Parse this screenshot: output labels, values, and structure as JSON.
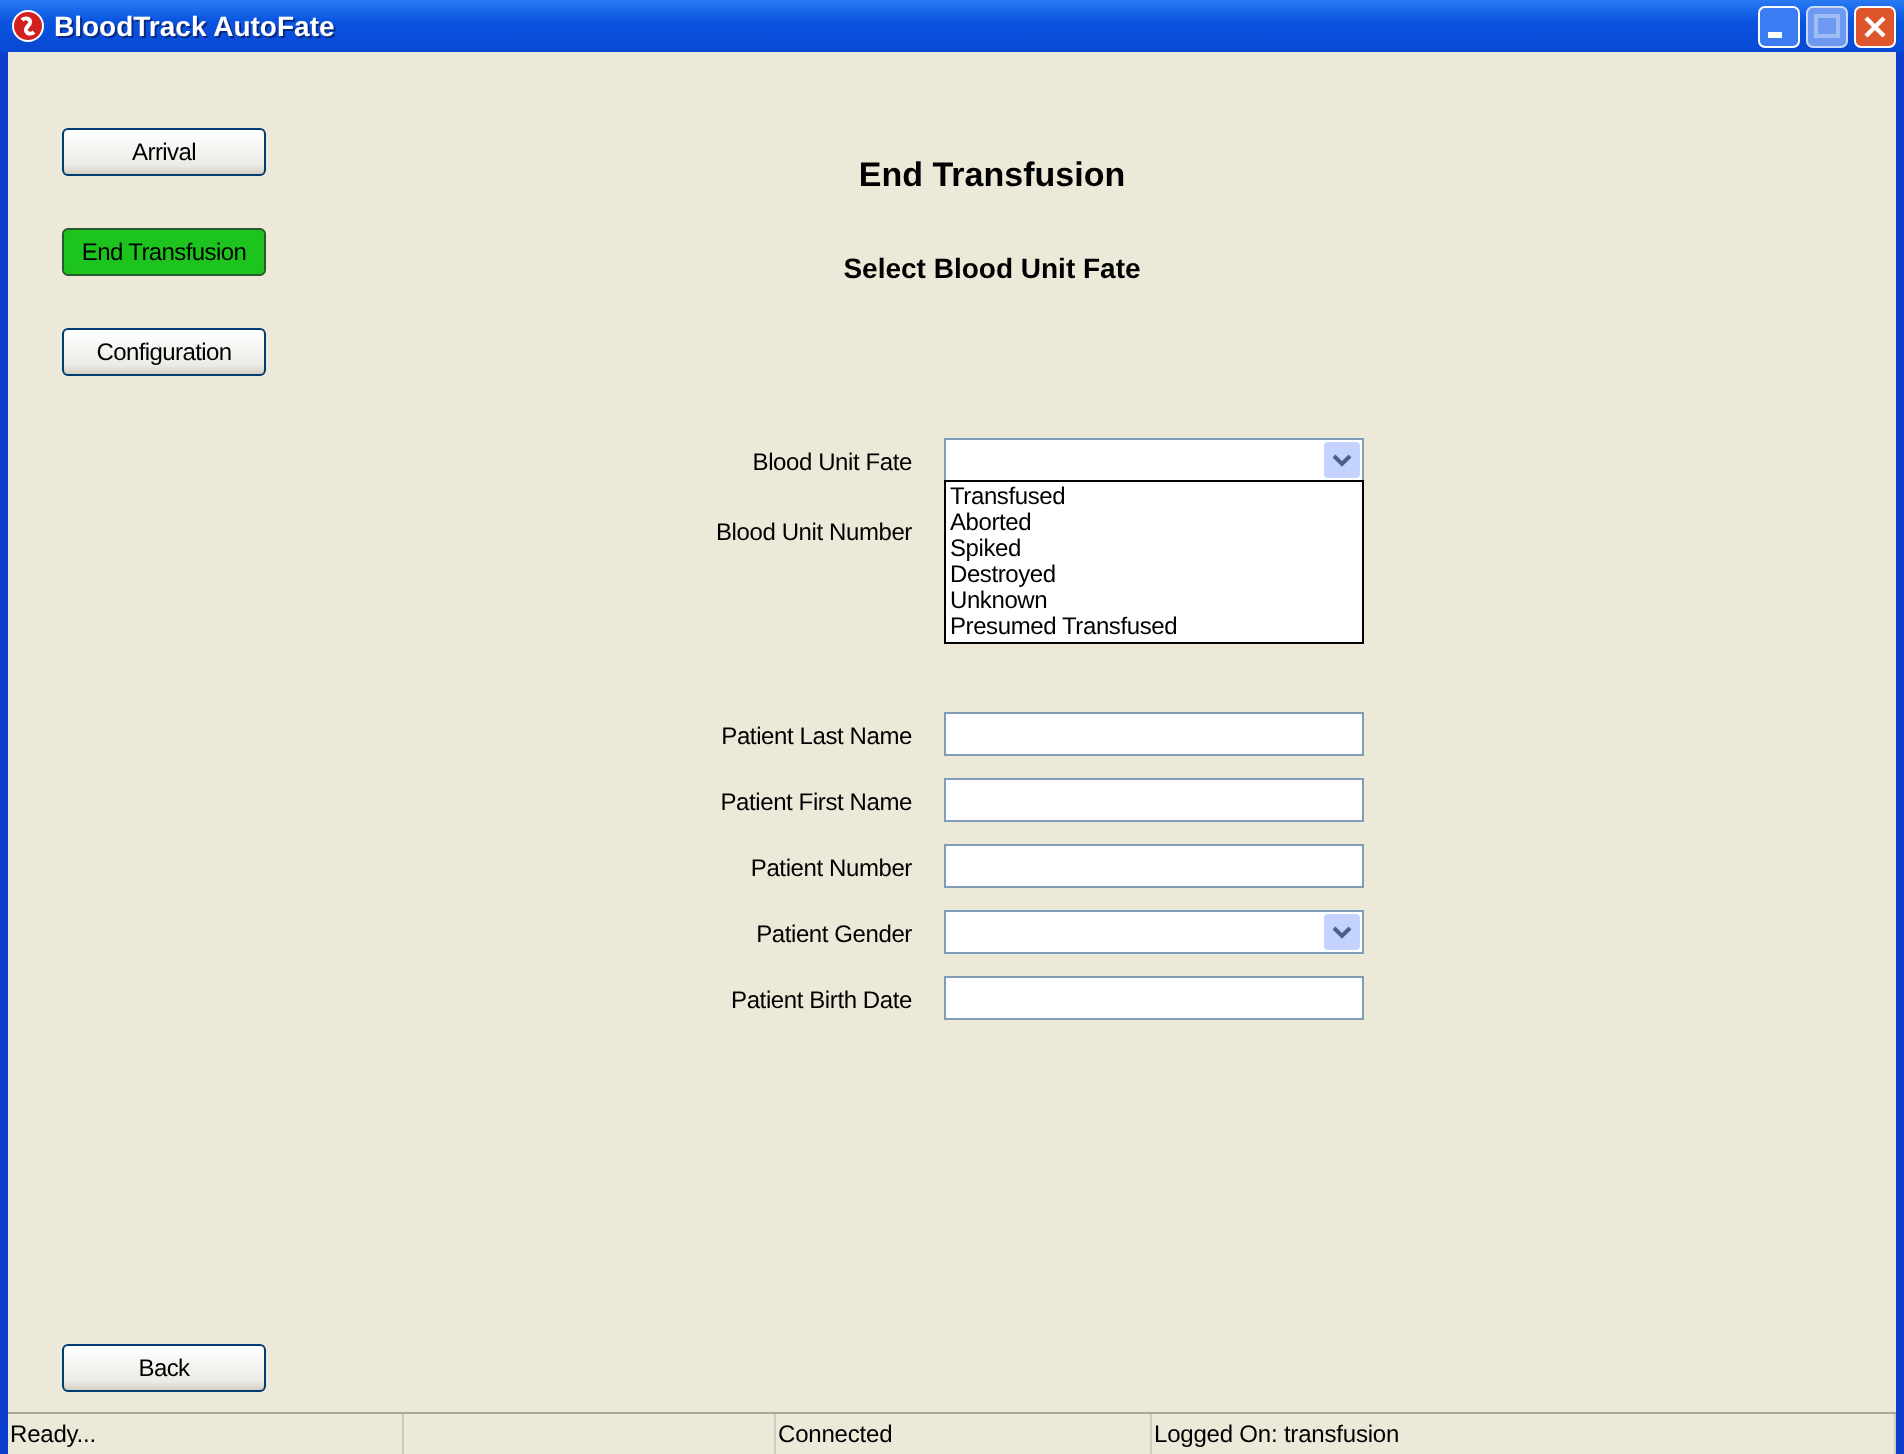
{
  "window": {
    "title": "BloodTrack AutoFate"
  },
  "sidebar": {
    "items": [
      {
        "label": "Arrival",
        "selected": false
      },
      {
        "label": "End Transfusion",
        "selected": true
      },
      {
        "label": "Configuration",
        "selected": false
      }
    ],
    "back_button": "Back"
  },
  "heading": "End Transfusion",
  "subheading": "Select Blood Unit Fate",
  "form": {
    "fields": [
      {
        "label": "Blood Unit Fate",
        "kind": "dropdown",
        "expanded": true,
        "options": [
          "Transfused",
          "Aborted",
          "Spiked",
          "Destroyed",
          "Unknown",
          "Presumed Transfused"
        ]
      },
      {
        "label": "Blood Unit Number",
        "kind": "hidden"
      },
      {
        "label": "Patient Last Name",
        "kind": "text"
      },
      {
        "label": "Patient First Name",
        "kind": "text"
      },
      {
        "label": "Patient Number",
        "kind": "text"
      },
      {
        "label": "Patient Gender",
        "kind": "dropdown",
        "expanded": false
      },
      {
        "label": "Patient Birth Date",
        "kind": "text"
      }
    ]
  },
  "status_bar": [
    "Ready...",
    "Connected",
    "Logged On: transfusion"
  ]
}
